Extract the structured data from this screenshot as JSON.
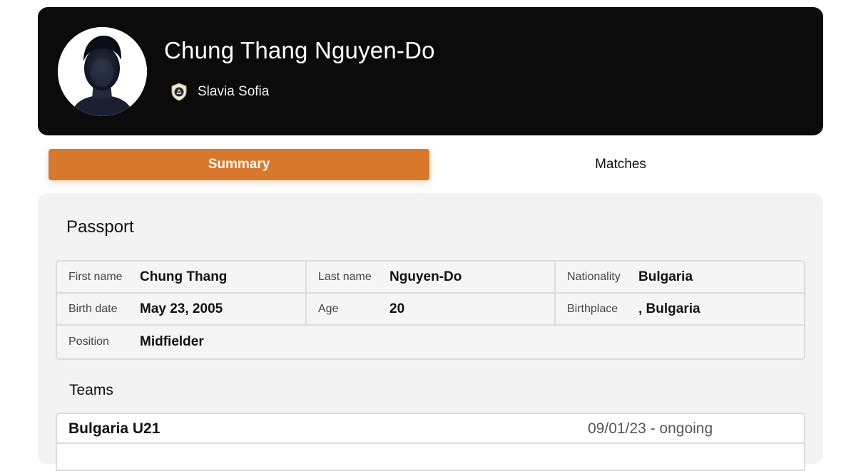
{
  "player": {
    "name": "Chung Thang Nguyen-Do",
    "club": "Slavia Sofia"
  },
  "tabs": [
    {
      "label": "Summary",
      "active": true
    },
    {
      "label": "Matches",
      "active": false
    }
  ],
  "passport": {
    "title": "Passport",
    "fields": {
      "first_name": {
        "label": "First name",
        "value": "Chung Thang"
      },
      "last_name": {
        "label": "Last name",
        "value": "Nguyen-Do"
      },
      "nationality": {
        "label": "Nationality",
        "value": "Bulgaria"
      },
      "birth_date": {
        "label": "Birth date",
        "value": "May 23, 2005"
      },
      "age": {
        "label": "Age",
        "value": "20"
      },
      "birthplace": {
        "label": "Birthplace",
        "value": ", Bulgaria"
      },
      "position": {
        "label": "Position",
        "value": "Midfielder"
      }
    }
  },
  "teams": {
    "title": "Teams",
    "rows": [
      {
        "name": "Bulgaria U21",
        "period": "09/01/23 - ongoing"
      }
    ]
  },
  "colors": {
    "header_bg": "#0b0b0b",
    "accent": "#d8782d",
    "panel_bg": "#f3f3f3"
  },
  "icons": {
    "avatar": "player-silhouette-icon",
    "club": "slavia-sofia-crest-icon"
  }
}
